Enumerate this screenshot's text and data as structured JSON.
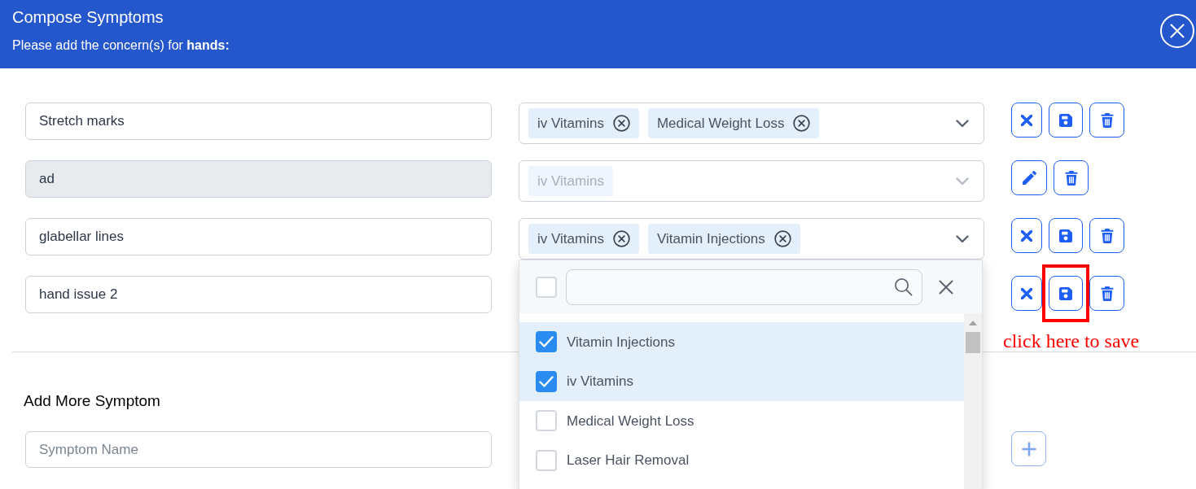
{
  "header": {
    "title": "Compose Symptoms",
    "subtitle": "Please add the concern(s) for **hands:**"
  },
  "symptoms": [
    {
      "name": "Stretch marks",
      "disabled": false,
      "tags": [
        {
          "label": "iv Vitamins"
        },
        {
          "label": "Medical Weight Loss"
        }
      ],
      "actions": [
        {
          "kind": "cancel",
          "highlighted": false
        },
        {
          "kind": "save",
          "highlighted": false
        },
        {
          "kind": "delete",
          "highlighted": false
        }
      ]
    },
    {
      "name": "ad",
      "disabled": true,
      "tags": [
        {
          "label": "iv Vitamins"
        }
      ],
      "actions": [
        {
          "kind": "edit",
          "highlighted": false
        },
        {
          "kind": "delete",
          "highlighted": false
        }
      ]
    },
    {
      "name": "glabellar lines",
      "disabled": false,
      "tags": [
        {
          "label": "iv Vitamins"
        },
        {
          "label": "Vitamin Injections"
        }
      ],
      "actions": [
        {
          "kind": "cancel",
          "highlighted": false
        },
        {
          "kind": "save",
          "highlighted": false
        },
        {
          "kind": "delete",
          "highlighted": false
        }
      ],
      "dropdown": {
        "select_all": {
          "checked": false
        },
        "options": [
          {
            "label": "Vitamin Injections",
            "checked": true
          },
          {
            "label": "iv Vitamins",
            "checked": true
          },
          {
            "label": "Medical Weight Loss",
            "checked": false
          },
          {
            "label": "Laser Hair Removal",
            "checked": false
          }
        ]
      }
    },
    {
      "name": "hand issue 2",
      "disabled": false,
      "actions": [
        {
          "kind": "cancel",
          "highlighted": false
        },
        {
          "kind": "save",
          "highlighted": true
        },
        {
          "kind": "delete",
          "highlighted": false
        }
      ],
      "note": "click here to save"
    }
  ],
  "add_more": {
    "title": "Add More Symptom",
    "placeholder": "Symptom Name",
    "add_button": {
      "disabled": true
    }
  }
}
